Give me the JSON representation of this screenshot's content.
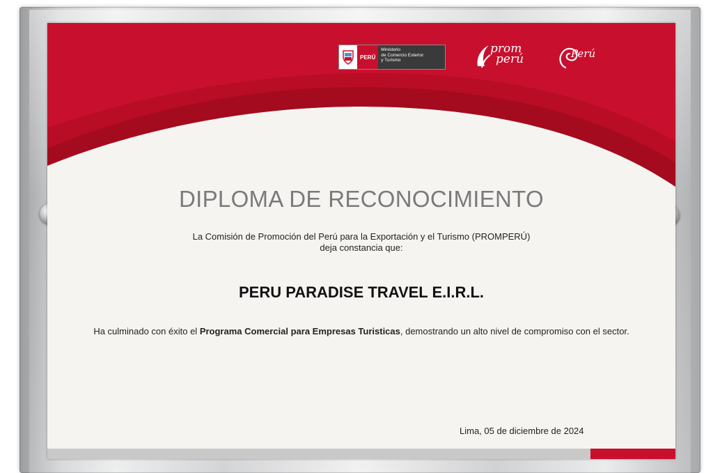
{
  "logos": {
    "mincetur_country": "PERÚ",
    "mincetur_text": "Ministerio\nde Comercio Exterior\ny Turismo",
    "promperu_line1": "prom",
    "promperu_line2": "perú",
    "marca_peru": "Perú"
  },
  "diploma": {
    "title": "DIPLOMA DE RECONOCIMIENTO",
    "intro_line1": "La Comisión de Promoción del Perú para la Exportación y el Turismo (PROMPERÚ)",
    "intro_line2": "deja constancia que:",
    "company": "PERU PARADISE TRAVEL E.I.R.L.",
    "body_prefix": "Ha culminado con éxito el ",
    "program": "Programa Comercial para Empresas Turisticas",
    "body_suffix": ", demostrando un alto nivel de compromiso con el sector.",
    "date": "Lima, 05 de diciembre de 2024"
  },
  "colors": {
    "brand_red": "#c8102e",
    "dark_red": "#9e0b1c",
    "paper": "#f5f4f1",
    "title_gray": "#7a7a7a"
  }
}
